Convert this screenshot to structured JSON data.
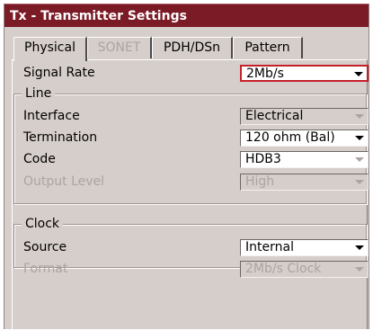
{
  "window": {
    "title": "Tx - Transmitter Settings"
  },
  "tabs": [
    {
      "label": "Physical",
      "state": "active"
    },
    {
      "label": "SONET",
      "state": "disabled"
    },
    {
      "label": "PDH/DSn",
      "state": "enabled"
    },
    {
      "label": "Pattern",
      "state": "enabled"
    }
  ],
  "signal_rate": {
    "label": "Signal Rate",
    "value": "2Mb/s"
  },
  "line_group": {
    "title": "Line",
    "interface": {
      "label": "Interface",
      "value": "Electrical"
    },
    "termination": {
      "label": "Termination",
      "value": "120 ohm (Bal)"
    },
    "code": {
      "label": "Code",
      "value": "HDB3"
    },
    "output_level": {
      "label": "Output Level",
      "value": "High"
    }
  },
  "clock_group": {
    "title": "Clock",
    "source": {
      "label": "Source",
      "value": "Internal"
    },
    "format": {
      "label": "Format",
      "value": "2Mb/s Clock"
    }
  },
  "colors": {
    "titlebar": "#7b1b26",
    "panel_background": "#d6ceca",
    "focus_border": "#c4202a",
    "disabled_text": "#aca4a1"
  },
  "icons": {
    "dropdown": "chevron-down-icon"
  }
}
